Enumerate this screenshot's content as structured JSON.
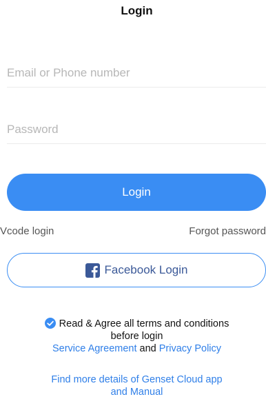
{
  "header": {
    "title": "Login"
  },
  "form": {
    "email": {
      "placeholder": "Email or Phone number",
      "value": ""
    },
    "password": {
      "placeholder": "Password",
      "value": ""
    },
    "login_label": "Login"
  },
  "links": {
    "vcode_login": "Vcode login",
    "forgot_password": "Forgot password"
  },
  "facebook": {
    "label": "Facebook Login",
    "icon": "facebook-icon"
  },
  "terms": {
    "checked": true,
    "line1": "Read & Agree all terms and conditions",
    "line2": "before login",
    "service_agreement": "Service Agreement",
    "and": "and",
    "privacy_policy": "Privacy Policy"
  },
  "details": {
    "line1": "Find more details of Genset Cloud app",
    "line2": "and Manual"
  },
  "colors": {
    "accent": "#3a8df3",
    "link": "#2f7fe8",
    "facebook": "#3b5998",
    "placeholder": "#b7b7b7"
  }
}
